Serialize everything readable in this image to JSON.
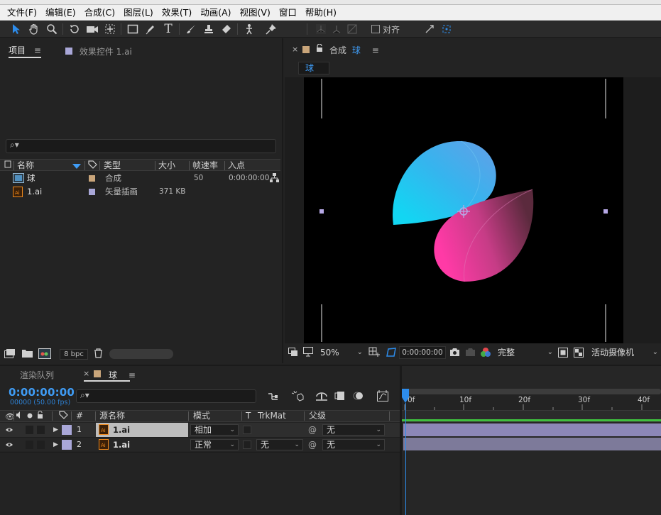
{
  "menu": [
    "文件(F)",
    "编辑(E)",
    "合成(C)",
    "图层(L)",
    "效果(T)",
    "动画(A)",
    "视图(V)",
    "窗口",
    "帮助(H)"
  ],
  "toolbar": {
    "tools": [
      "selection-tool",
      "hand-tool",
      "zoom-tool",
      "rotate-tool",
      "camera-tool",
      "pan-behind-tool",
      "rectangle-tool",
      "pen-tool",
      "type-tool",
      "brush-tool",
      "clone-stamp-tool",
      "eraser-tool",
      "roto-brush-tool",
      "puppet-pin-tool"
    ],
    "snap_label": "对齐"
  },
  "project_panel": {
    "tab_project": "项目",
    "tab_effects": "效果控件 1.ai",
    "effects_swatch_color": "#a9a7d8",
    "columns": [
      "名称",
      "类型",
      "大小",
      "帧速率",
      "入点"
    ],
    "rows": [
      {
        "name": "球",
        "label_color": "#c9a57a",
        "type": "合成",
        "size": "",
        "fps": "50",
        "in_point": "0:00:00:00",
        "icon": "composition-icon"
      },
      {
        "name": "1.ai",
        "label_color": "#a9a7d8",
        "type": "矢量插画",
        "size": "371 KB",
        "fps": "",
        "in_point": "",
        "icon": "illustrator-file-icon"
      }
    ],
    "bpc": "8 bpc"
  },
  "comp_panel": {
    "tab_label": "合成",
    "comp_name": "球",
    "swatch_color": "#c9a57a",
    "breadcrumb": "球",
    "zoom": "50%",
    "timecode": "0:00:00:00",
    "resolution": "完整",
    "camera": "活动摄像机"
  },
  "timeline": {
    "tab_render_queue": "渲染队列",
    "tab_comp": "球",
    "timecode": "0:00:00:00",
    "frame_info": "00000 (50.00 fps)",
    "columns": {
      "num": "#",
      "source": "源名称",
      "mode": "模式",
      "t": "T",
      "trkmat": "TrkMat",
      "parent": "父级"
    },
    "layers": [
      {
        "num": "1",
        "name": "1.ai",
        "mode": "相加",
        "trkmat": "",
        "parent": "无",
        "selected": true
      },
      {
        "num": "2",
        "name": "1.ai",
        "mode": "正常",
        "trkmat": "无",
        "parent": "无",
        "selected": false
      }
    ],
    "ruler": [
      "0f",
      "10f",
      "20f",
      "30f",
      "40f"
    ],
    "layer_color": "#a9a7d8"
  },
  "colors": {
    "accent_blue": "#2d8ceb",
    "timecode_blue": "#3f9cf5",
    "ball_cyan": "#12d6f2",
    "ball_pink": "#f73a9c"
  }
}
